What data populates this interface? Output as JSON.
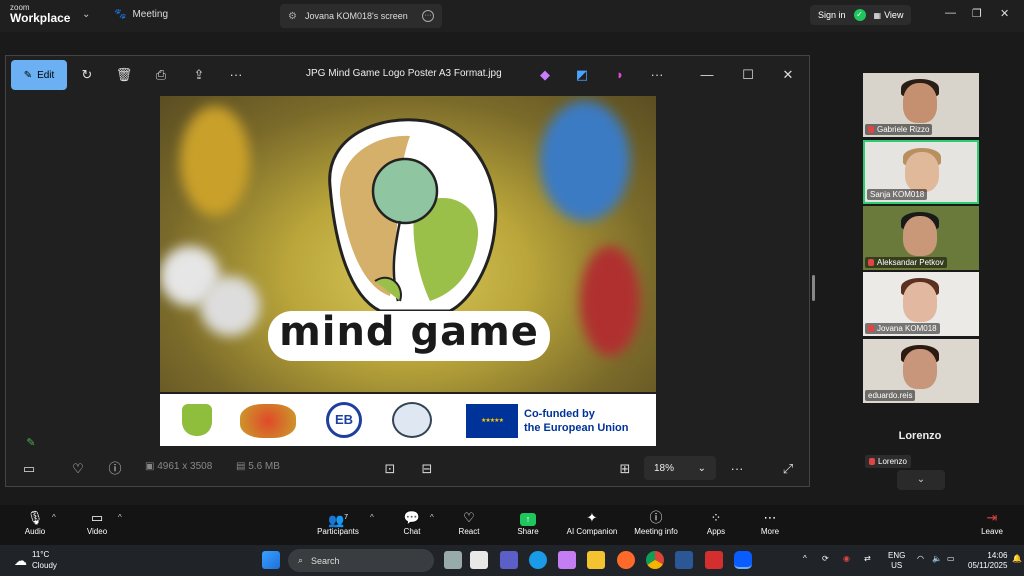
{
  "app": {
    "brand_top": "zoom",
    "brand_name": "Workplace",
    "meeting_label": "Meeting",
    "share_tab_label": "Jovana KOM018's screen",
    "signin_label": "Sign in",
    "view_label": "View"
  },
  "viewer": {
    "edit_label": "Edit",
    "file_title": "JPG Mind Game Logo Poster A3 Format.jpg",
    "dimensions": "4961 x 3508",
    "file_size": "5.6 MB",
    "zoom_level": "18%",
    "logo_text": "mind game",
    "eu_text_line1": "Co-funded by",
    "eu_text_line2": "the European Union",
    "eu_flag_color": "#003399",
    "eu_star_color": "#ffcc00"
  },
  "participants": [
    {
      "name": "Gabriele Rizzo"
    },
    {
      "name": "Sanja KOM018"
    },
    {
      "name": "Aleksandar Petkov"
    },
    {
      "name": "Jovana KOM018"
    },
    {
      "name": "eduardo.reis"
    }
  ],
  "active_speaker": {
    "display_name": "Lorenzo",
    "label": "Lorenzo"
  },
  "controls": {
    "audio": "Audio",
    "video": "Video",
    "participants": "Participants",
    "participants_count": "7",
    "chat": "Chat",
    "react": "React",
    "share": "Share",
    "ai_companion": "AI Companion",
    "meeting_info": "Meeting info",
    "apps": "Apps",
    "more": "More",
    "leave": "Leave"
  },
  "taskbar": {
    "temperature": "11°C",
    "weather": "Cloudy",
    "search_placeholder": "Search",
    "lang_top": "ENG",
    "lang_bottom": "US",
    "time": "14:06",
    "date": "05/11/2025"
  },
  "colors": {
    "accent": "#6ab0f2",
    "share_green": "#21c55d",
    "leave_red": "#e04444",
    "active_border": "#2ecc71"
  }
}
